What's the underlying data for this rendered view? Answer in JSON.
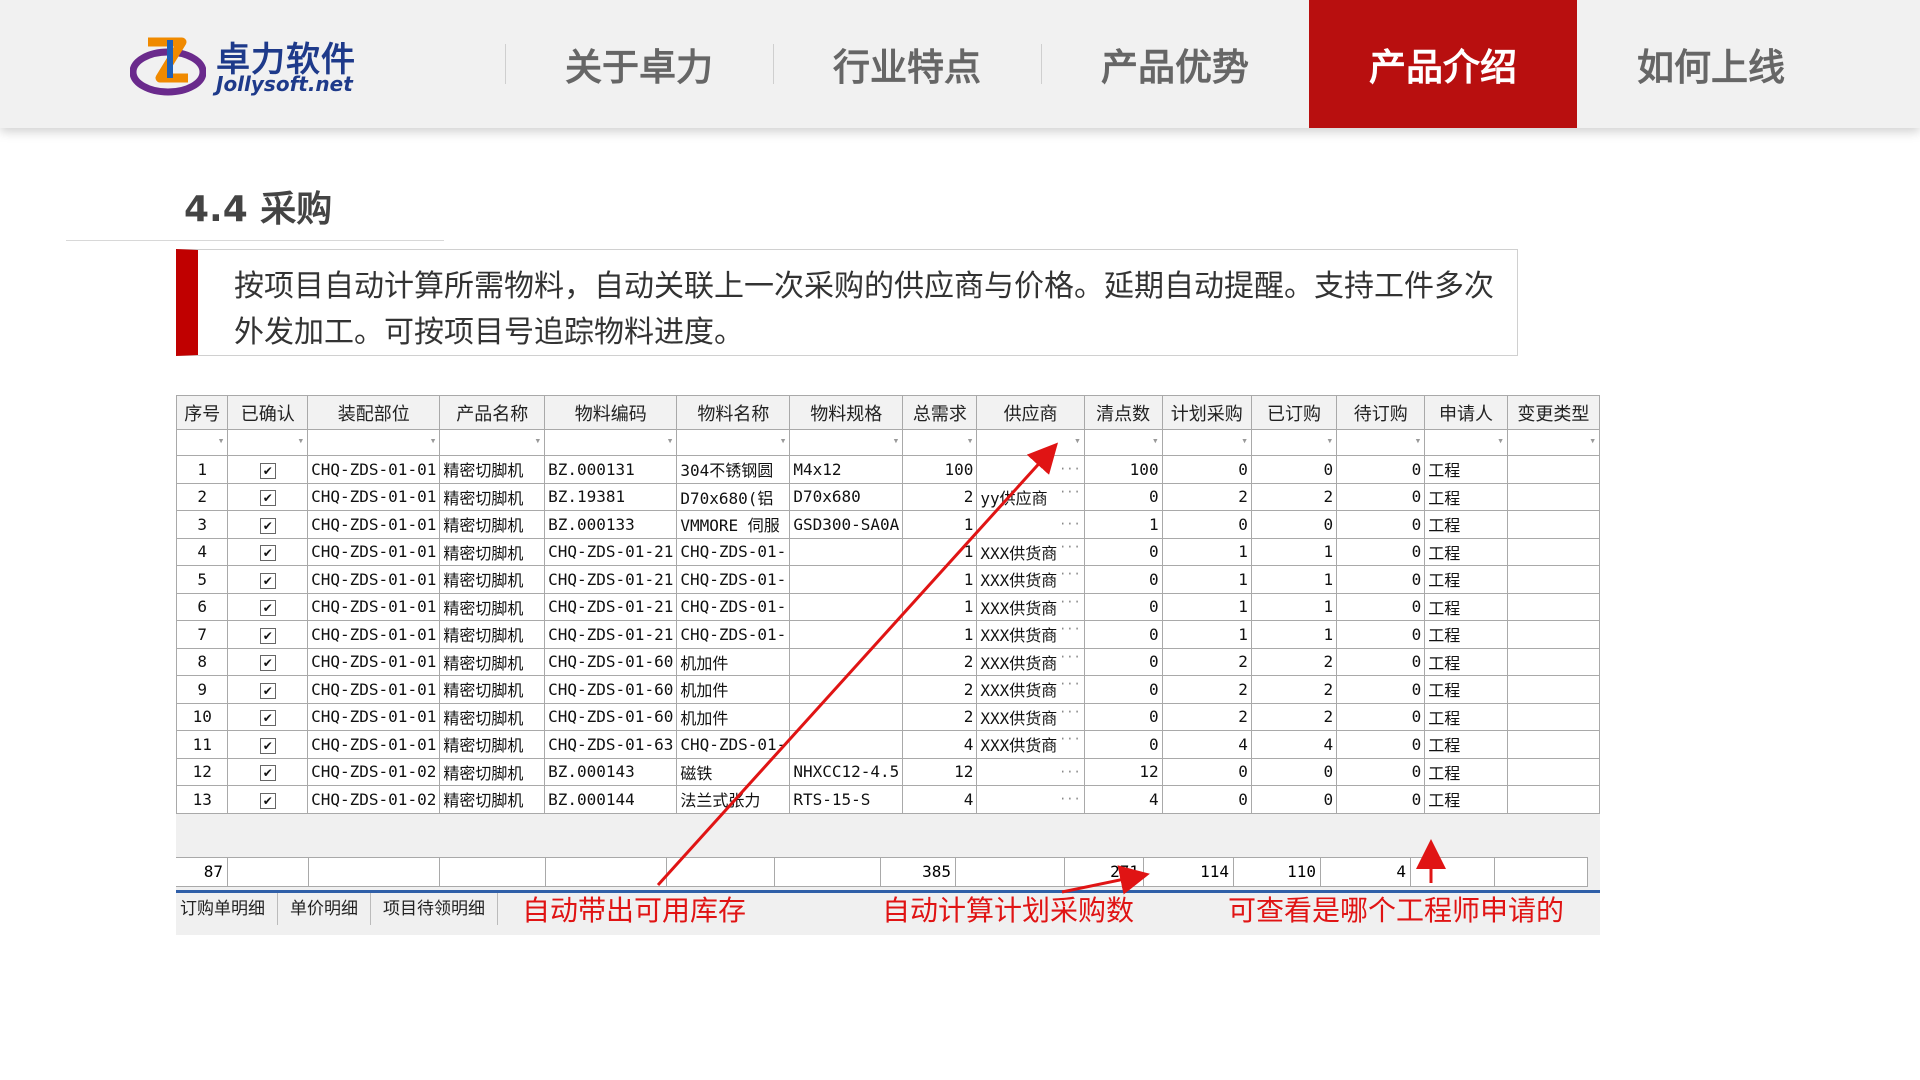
{
  "brand": {
    "name_cn": "卓力软件",
    "name_en": "Jollysoft.net"
  },
  "nav": [
    "关于卓力",
    "行业特点",
    "产品优势",
    "产品介绍",
    "如何上线"
  ],
  "nav_active_index": 3,
  "colors": {
    "accent": "#b80f0f",
    "highlight_green": "#0e8a12",
    "highlight_purple": "#b49aff",
    "annotation": "#e01414"
  },
  "section": {
    "title": "4.4 采购",
    "description": "按项目自动计算所需物料，自动关联上一次采购的供应商与价格。延期自动提醒。支持工件多次外发加工。可按项目号追踪物料进度。"
  },
  "grid": {
    "columns": [
      "序号",
      "已确认",
      "装配部位",
      "产品名称",
      "物料编码",
      "物料名称",
      "物料规格",
      "总需求",
      "供应商",
      "清点数",
      "计划采购",
      "已订购",
      "待订购",
      "申请人",
      "变更类型"
    ],
    "rows": [
      {
        "no": "1",
        "confirmed": true,
        "part": "CHQ-ZDS-01-01",
        "product": "精密切脚机",
        "code": "BZ.000131",
        "name": "304不锈钢圆",
        "spec": "M4x12",
        "total": "100",
        "supplier": "",
        "count": "100",
        "plan": "0",
        "ordered": "0",
        "pending": "0",
        "applicant": "工程",
        "change": "",
        "green": [],
        "purple": true
      },
      {
        "no": "2",
        "confirmed": true,
        "part": "CHQ-ZDS-01-01",
        "product": "精密切脚机",
        "code": "BZ.19381",
        "name": "D70x680(铝",
        "spec": "D70x680",
        "total": "2",
        "supplier": "yy供应商",
        "count": "0",
        "plan": "2",
        "ordered": "2",
        "pending": "0",
        "applicant": "工程",
        "change": "",
        "green": [
          "code",
          "name",
          "spec"
        ],
        "purple": false
      },
      {
        "no": "3",
        "confirmed": true,
        "part": "CHQ-ZDS-01-01",
        "product": "精密切脚机",
        "code": "BZ.000133",
        "name": "VMMORE 伺服",
        "spec": "GSD300-SA0A",
        "total": "1",
        "supplier": "",
        "count": "1",
        "plan": "0",
        "ordered": "0",
        "pending": "0",
        "applicant": "工程",
        "change": "",
        "green": [],
        "purple": true
      },
      {
        "no": "4",
        "confirmed": true,
        "part": "CHQ-ZDS-01-01",
        "product": "精密切脚机",
        "code": "CHQ-ZDS-01-21",
        "name": "CHQ-ZDS-01-",
        "spec": "",
        "total": "1",
        "supplier": "XXX供货商",
        "count": "0",
        "plan": "1",
        "ordered": "1",
        "pending": "0",
        "applicant": "工程",
        "change": "",
        "green": [
          "code",
          "name",
          "spec"
        ],
        "purple": false
      },
      {
        "no": "5",
        "confirmed": true,
        "part": "CHQ-ZDS-01-01",
        "product": "精密切脚机",
        "code": "CHQ-ZDS-01-21",
        "name": "CHQ-ZDS-01-",
        "spec": "",
        "total": "1",
        "supplier": "XXX供货商",
        "count": "0",
        "plan": "1",
        "ordered": "1",
        "pending": "0",
        "applicant": "工程",
        "change": "",
        "green": [
          "code",
          "name",
          "spec"
        ],
        "purple": false
      },
      {
        "no": "6",
        "confirmed": true,
        "part": "CHQ-ZDS-01-01",
        "product": "精密切脚机",
        "code": "CHQ-ZDS-01-21",
        "name": "CHQ-ZDS-01-",
        "spec": "",
        "total": "1",
        "supplier": "XXX供货商",
        "count": "0",
        "plan": "1",
        "ordered": "1",
        "pending": "0",
        "applicant": "工程",
        "change": "",
        "green": [
          "code",
          "name",
          "spec"
        ],
        "purple": false
      },
      {
        "no": "7",
        "confirmed": true,
        "part": "CHQ-ZDS-01-01",
        "product": "精密切脚机",
        "code": "CHQ-ZDS-01-21",
        "name": "CHQ-ZDS-01-",
        "spec": "",
        "total": "1",
        "supplier": "XXX供货商",
        "count": "0",
        "plan": "1",
        "ordered": "1",
        "pending": "0",
        "applicant": "工程",
        "change": "",
        "green": [
          "code",
          "name",
          "spec"
        ],
        "purple": false
      },
      {
        "no": "8",
        "confirmed": true,
        "part": "CHQ-ZDS-01-01",
        "product": "精密切脚机",
        "code": "CHQ-ZDS-01-60",
        "name": "机加件",
        "spec": "",
        "total": "2",
        "supplier": "XXX供货商",
        "count": "0",
        "plan": "2",
        "ordered": "2",
        "pending": "0",
        "applicant": "工程",
        "change": "",
        "green": [
          "code",
          "name",
          "spec"
        ],
        "purple": false
      },
      {
        "no": "9",
        "confirmed": true,
        "part": "CHQ-ZDS-01-01",
        "product": "精密切脚机",
        "code": "CHQ-ZDS-01-60",
        "name": "机加件",
        "spec": "",
        "total": "2",
        "supplier": "XXX供货商",
        "count": "0",
        "plan": "2",
        "ordered": "2",
        "pending": "0",
        "applicant": "工程",
        "change": "",
        "green": [
          "code",
          "name",
          "spec"
        ],
        "purple": false
      },
      {
        "no": "10",
        "confirmed": true,
        "part": "CHQ-ZDS-01-01",
        "product": "精密切脚机",
        "code": "CHQ-ZDS-01-60",
        "name": "机加件",
        "spec": "",
        "total": "2",
        "supplier": "XXX供货商",
        "count": "0",
        "plan": "2",
        "ordered": "2",
        "pending": "0",
        "applicant": "工程",
        "change": "",
        "green": [
          "code",
          "name",
          "spec"
        ],
        "purple": false
      },
      {
        "no": "11",
        "confirmed": true,
        "part": "CHQ-ZDS-01-01",
        "product": "精密切脚机",
        "code": "CHQ-ZDS-01-63",
        "name": "CHQ-ZDS-01-",
        "spec": "",
        "total": "4",
        "supplier": "XXX供货商",
        "count": "0",
        "plan": "4",
        "ordered": "4",
        "pending": "0",
        "applicant": "工程",
        "change": "",
        "green": [
          "code",
          "name",
          "spec"
        ],
        "purple": false
      },
      {
        "no": "12",
        "confirmed": true,
        "part": "CHQ-ZDS-01-02",
        "product": "精密切脚机",
        "code": "BZ.000143",
        "name": "磁铁",
        "spec": "NHXCC12-4.5",
        "total": "12",
        "supplier": "",
        "count": "12",
        "plan": "0",
        "ordered": "0",
        "pending": "0",
        "applicant": "工程",
        "change": "",
        "green": [],
        "purple": true
      },
      {
        "no": "13",
        "confirmed": true,
        "part": "CHQ-ZDS-01-02",
        "product": "精密切脚机",
        "code": "BZ.000144",
        "name": "法兰式张力",
        "spec": "RTS-15-S",
        "total": "4",
        "supplier": "",
        "count": "4",
        "plan": "0",
        "ordered": "0",
        "pending": "0",
        "applicant": "工程",
        "change": "",
        "green": [],
        "purple": true
      }
    ],
    "summary": {
      "rows": "87",
      "total": "385",
      "count": "271",
      "plan": "114",
      "ordered": "110",
      "pending": "4"
    },
    "tabs": [
      "订购单明细",
      "单价明细",
      "项目待领明细"
    ]
  },
  "annotations": [
    "自动带出可用库存",
    "自动计算计划采购数",
    "可查看是哪个工程师申请的"
  ]
}
